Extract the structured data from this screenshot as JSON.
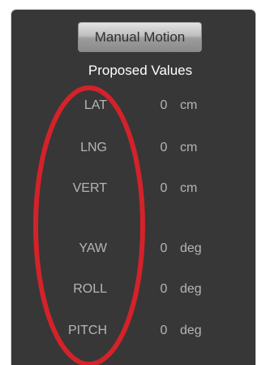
{
  "panel": {
    "button_label": "Manual Motion",
    "section_title": "Proposed Values"
  },
  "params": [
    {
      "label": "LAT",
      "value": "0",
      "unit": "cm"
    },
    {
      "label": "LNG",
      "value": "0",
      "unit": "cm"
    },
    {
      "label": "VERT",
      "value": "0",
      "unit": "cm"
    },
    {
      "label": "YAW",
      "value": "0",
      "unit": "deg"
    },
    {
      "label": "ROLL",
      "value": "0",
      "unit": "deg"
    },
    {
      "label": "PITCH",
      "value": "0",
      "unit": "deg"
    }
  ],
  "colors": {
    "panel_background": "#373737",
    "highlight_ring": "#d3222a",
    "value_text": "#b5b5b5"
  }
}
